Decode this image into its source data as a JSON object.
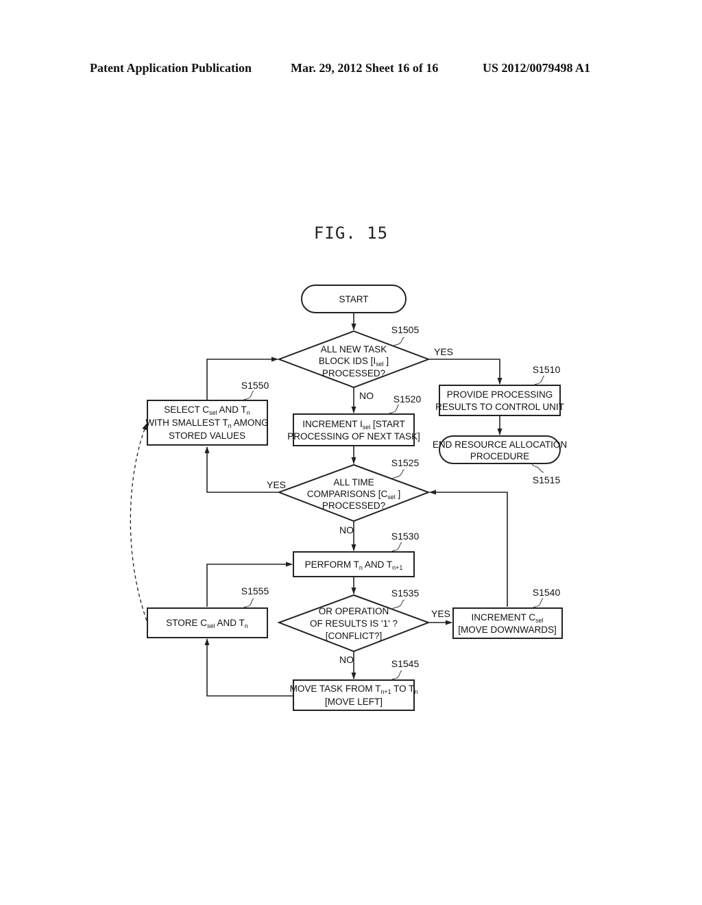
{
  "header": {
    "publication_type": "Patent Application Publication",
    "date_sheet": "Mar. 29, 2012  Sheet 16 of 16",
    "patent_number": "US 2012/0079498 A1"
  },
  "figure": {
    "title": "FIG. 15"
  },
  "flowchart": {
    "start": {
      "label": "START"
    },
    "s1505": {
      "step": "S1505",
      "lines": [
        "ALL NEW TASK",
        "BLOCK IDS [I",
        "sel",
        " ]",
        "PROCESSED?"
      ]
    },
    "s1510": {
      "step": "S1510",
      "lines": [
        "PROVIDE PROCESSING",
        "RESULTS TO CONTROL UNIT"
      ]
    },
    "s1515": {
      "step": "S1515",
      "lines": [
        "END RESOURCE ALLOCATION",
        "PROCEDURE"
      ]
    },
    "s1520": {
      "step": "S1520",
      "line1_a": "INCREMENT I",
      "line1_sub": "sel",
      "line1_b": "  [START",
      "line2": "PROCESSING OF NEXT TASK]"
    },
    "s1525": {
      "step": "S1525",
      "line1": "ALL TIME",
      "line2_a": "COMPARISONS [C",
      "line2_sub": "sel",
      "line2_b": " ]",
      "line3": "PROCESSED?"
    },
    "s1530": {
      "step": "S1530",
      "a": "PERFORM T",
      "sub1": "n",
      "b": " AND T",
      "sub2": "n+1"
    },
    "s1535": {
      "step": "S1535",
      "lines": [
        "OR OPERATION",
        "OF RESULTS IS '1' ?",
        "[CONFLICT?]"
      ]
    },
    "s1540": {
      "step": "S1540",
      "line1_a": "INCREMENT C",
      "line1_sub": "sel",
      "line2": "[MOVE DOWNWARDS]"
    },
    "s1545": {
      "step": "S1545",
      "line1_a": "MOVE TASK FROM T",
      "line1_sub1": "n+1",
      "line1_b": " TO T",
      "line1_sub2": "n",
      "line2": "[MOVE LEFT]"
    },
    "s1550": {
      "step": "S1550",
      "l1_a": "SELECT C",
      "l1_sub": "sel",
      "l1_b": " AND T",
      "l1_sub2": "n",
      "l2_a": "WITH SMALLEST T",
      "l2_sub": "n",
      "l2_b": "  AMONG",
      "l3": "STORED VALUES"
    },
    "s1555": {
      "step": "S1555",
      "a": "STORE C",
      "sub1": "sel",
      "b": " AND T",
      "sub2": "n"
    },
    "branch_labels": {
      "yes": "YES",
      "no": "NO"
    }
  }
}
